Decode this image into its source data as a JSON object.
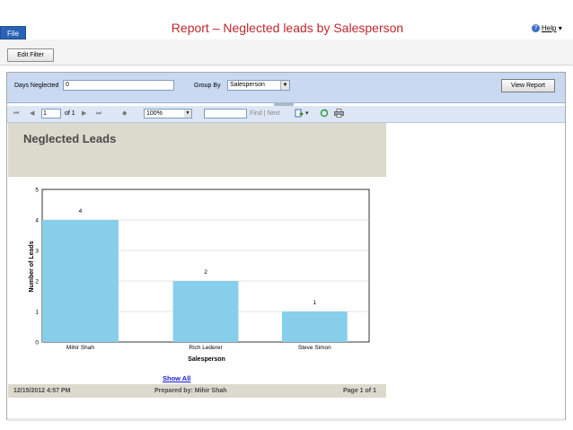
{
  "window": {
    "file_label": "File",
    "title": "Report – Neglected leads by Salesperson",
    "help_label": "Help"
  },
  "toolbar": {
    "edit_filter_label": "Edit Filter"
  },
  "parameters": {
    "days_label": "Days Neglected",
    "days_value": "0",
    "group_by_label": "Group By",
    "group_by_value": "Salesperson",
    "view_report_label": "View Report"
  },
  "navigation": {
    "page_value": "1",
    "page_of": "of 1",
    "zoom_value": "100%",
    "find_label": "Find | Next",
    "first_glyph": "⏮",
    "prev_glyph": "◀",
    "next_glyph": "▶",
    "last_glyph": "⏭",
    "back_glyph": "◆"
  },
  "report": {
    "heading": "Neglected Leads",
    "show_all_label": "Show All",
    "footer_date": "12/15/2012 4:57 PM",
    "footer_prepared": "Prepared by: Mihir Shah",
    "footer_page": "Page 1 of 1"
  },
  "chart_data": {
    "type": "bar",
    "categories": [
      "Mihir Shah",
      "Rich Lederer",
      "Steve Simon"
    ],
    "values": [
      4,
      2,
      1
    ],
    "data_labels": [
      "4",
      "2",
      "1"
    ],
    "xlabel": "Salesperson",
    "ylabel": "Number of Leads",
    "ylim": [
      0,
      5
    ],
    "yticks": [
      "0",
      "1",
      "2",
      "3",
      "4",
      "5"
    ],
    "grid": true,
    "bar_color": "#87ceeb"
  },
  "colors": {
    "title_red": "#c0282d",
    "param_blue": "#c9d9f2",
    "report_band": "#dcd9cd",
    "link_blue": "#1a1ad0"
  }
}
